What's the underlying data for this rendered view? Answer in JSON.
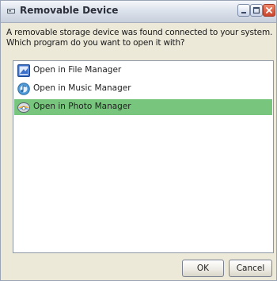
{
  "window": {
    "title": "Removable Device"
  },
  "prompt": {
    "text": "A removable storage device was found connected to your system. Which program do you want to open it with?"
  },
  "list": {
    "items": [
      {
        "label": "Open in File Manager",
        "icon": "file-manager-icon",
        "selected": false
      },
      {
        "label": "Open in Music Manager",
        "icon": "music-manager-icon",
        "selected": false
      },
      {
        "label": "Open in Photo Manager",
        "icon": "photo-manager-icon",
        "selected": true
      }
    ],
    "selection_color": "#78c67d"
  },
  "buttons": {
    "ok_label": "OK",
    "cancel_label": "Cancel"
  }
}
